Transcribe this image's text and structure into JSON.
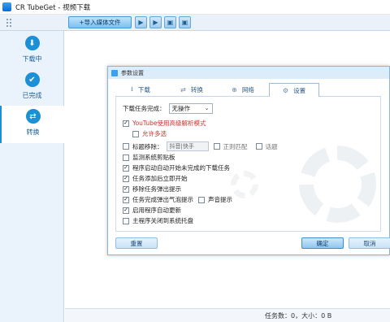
{
  "window": {
    "title": "CR TubeGet - 视频下载"
  },
  "toolbar": {
    "import_label": "+导入媒体文件",
    "icons": [
      "play-icon",
      "play-icon",
      "image-icon",
      "image-icon"
    ]
  },
  "sidebar": {
    "items": [
      {
        "label": "下载中",
        "icon": "download-icon"
      },
      {
        "label": "已完成",
        "icon": "check-icon"
      },
      {
        "label": "转换",
        "icon": "convert-icon"
      }
    ]
  },
  "status": {
    "text": "任务数：0，大小：0 B"
  },
  "dialog": {
    "title": "参数设置",
    "tabs": [
      {
        "label": "下载",
        "icon": "download-icon"
      },
      {
        "label": "转换",
        "icon": "convert-icon"
      },
      {
        "label": "网络",
        "icon": "globe-icon"
      },
      {
        "label": "设置",
        "icon": "gear-icon"
      }
    ],
    "settings": {
      "on_complete_label": "下载任务完成：",
      "on_complete_value": "无操作",
      "youtube_label": "YouTube使用高级解析模式",
      "allow_multi_label": "允许多选",
      "remove_title_label": "标题移除：",
      "remove_title_placeholder": "抖音|快手",
      "regex_label": "正则匹配",
      "topic_label": "话题",
      "monitor_clipboard_label": "监测系统剪贴板",
      "auto_start_label": "程序启动自动开始未完成的下载任务",
      "start_on_add_label": "任务添加后立即开始",
      "remove_prompt_label": "移除任务弹出提示",
      "bubble_label": "任务完成弹出气泡提示",
      "sound_label": "声音提示",
      "auto_update_label": "启用程序自动更新",
      "close_to_tray_label": "主程序关闭到系统托盘"
    },
    "buttons": {
      "reset": "重置",
      "ok": "确定",
      "cancel": "取消"
    }
  }
}
